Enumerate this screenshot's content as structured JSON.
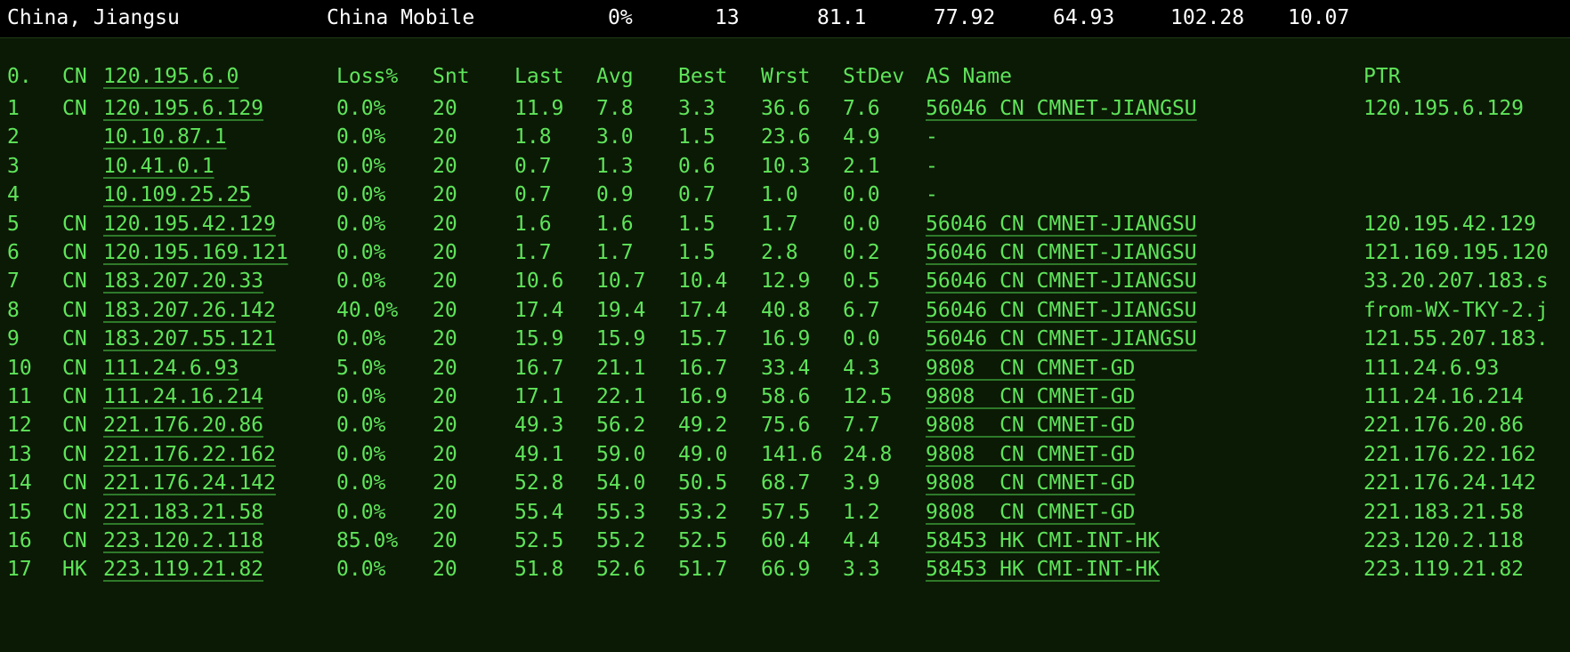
{
  "summary": {
    "location": "China, Jiangsu",
    "isp": "China Mobile",
    "loss": "0%",
    "count": "13",
    "v1": "81.1",
    "v2": "77.92",
    "v3": "64.93",
    "v4": "102.28",
    "v5": "10.07"
  },
  "header": {
    "hop": "0.",
    "cc": "CN",
    "ip": "120.195.6.0",
    "loss": "Loss%",
    "snt": "Snt",
    "last": "Last",
    "avg": "Avg",
    "best": "Best",
    "wrst": "Wrst",
    "stdev": "StDev",
    "as": "AS Name",
    "ptr": "PTR"
  },
  "rows": [
    {
      "hop": "1",
      "cc": "CN",
      "ip": "120.195.6.129",
      "loss": "0.0%",
      "snt": "20",
      "last": "11.9",
      "avg": "7.8",
      "best": "3.3",
      "wrst": "36.6",
      "stdev": "7.6",
      "as": "56046 CN CMNET-JIANGSU",
      "ptr": "120.195.6.129"
    },
    {
      "hop": "2",
      "cc": "",
      "ip": "10.10.87.1",
      "loss": "0.0%",
      "snt": "20",
      "last": "1.8",
      "avg": "3.0",
      "best": "1.5",
      "wrst": "23.6",
      "stdev": "4.9",
      "as": "-",
      "ptr": ""
    },
    {
      "hop": "3",
      "cc": "",
      "ip": "10.41.0.1",
      "loss": "0.0%",
      "snt": "20",
      "last": "0.7",
      "avg": "1.3",
      "best": "0.6",
      "wrst": "10.3",
      "stdev": "2.1",
      "as": "-",
      "ptr": ""
    },
    {
      "hop": "4",
      "cc": "",
      "ip": "10.109.25.25",
      "loss": "0.0%",
      "snt": "20",
      "last": "0.7",
      "avg": "0.9",
      "best": "0.7",
      "wrst": "1.0",
      "stdev": "0.0",
      "as": "-",
      "ptr": ""
    },
    {
      "hop": "5",
      "cc": "CN",
      "ip": "120.195.42.129",
      "loss": "0.0%",
      "snt": "20",
      "last": "1.6",
      "avg": "1.6",
      "best": "1.5",
      "wrst": "1.7",
      "stdev": "0.0",
      "as": "56046 CN CMNET-JIANGSU",
      "ptr": "120.195.42.129"
    },
    {
      "hop": "6",
      "cc": "CN",
      "ip": "120.195.169.121",
      "loss": "0.0%",
      "snt": "20",
      "last": "1.7",
      "avg": "1.7",
      "best": "1.5",
      "wrst": "2.8",
      "stdev": "0.2",
      "as": "56046 CN CMNET-JIANGSU",
      "ptr": "121.169.195.120"
    },
    {
      "hop": "7",
      "cc": "CN",
      "ip": "183.207.20.33",
      "loss": "0.0%",
      "snt": "20",
      "last": "10.6",
      "avg": "10.7",
      "best": "10.4",
      "wrst": "12.9",
      "stdev": "0.5",
      "as": "56046 CN CMNET-JIANGSU",
      "ptr": "33.20.207.183.s"
    },
    {
      "hop": "8",
      "cc": "CN",
      "ip": "183.207.26.142",
      "loss": "40.0%",
      "snt": "20",
      "last": "17.4",
      "avg": "19.4",
      "best": "17.4",
      "wrst": "40.8",
      "stdev": "6.7",
      "as": "56046 CN CMNET-JIANGSU",
      "ptr": "from-WX-TKY-2.j"
    },
    {
      "hop": "9",
      "cc": "CN",
      "ip": "183.207.55.121",
      "loss": "0.0%",
      "snt": "20",
      "last": "15.9",
      "avg": "15.9",
      "best": "15.7",
      "wrst": "16.9",
      "stdev": "0.0",
      "as": "56046 CN CMNET-JIANGSU",
      "ptr": "121.55.207.183."
    },
    {
      "hop": "10",
      "cc": "CN",
      "ip": "111.24.6.93",
      "loss": "5.0%",
      "snt": "20",
      "last": "16.7",
      "avg": "21.1",
      "best": "16.7",
      "wrst": "33.4",
      "stdev": "4.3",
      "as": "9808  CN CMNET-GD",
      "ptr": "111.24.6.93"
    },
    {
      "hop": "11",
      "cc": "CN",
      "ip": "111.24.16.214",
      "loss": "0.0%",
      "snt": "20",
      "last": "17.1",
      "avg": "22.1",
      "best": "16.9",
      "wrst": "58.6",
      "stdev": "12.5",
      "as": "9808  CN CMNET-GD",
      "ptr": "111.24.16.214"
    },
    {
      "hop": "12",
      "cc": "CN",
      "ip": "221.176.20.86",
      "loss": "0.0%",
      "snt": "20",
      "last": "49.3",
      "avg": "56.2",
      "best": "49.2",
      "wrst": "75.6",
      "stdev": "7.7",
      "as": "9808  CN CMNET-GD",
      "ptr": "221.176.20.86"
    },
    {
      "hop": "13",
      "cc": "CN",
      "ip": "221.176.22.162",
      "loss": "0.0%",
      "snt": "20",
      "last": "49.1",
      "avg": "59.0",
      "best": "49.0",
      "wrst": "141.6",
      "stdev": "24.8",
      "as": "9808  CN CMNET-GD",
      "ptr": "221.176.22.162"
    },
    {
      "hop": "14",
      "cc": "CN",
      "ip": "221.176.24.142",
      "loss": "0.0%",
      "snt": "20",
      "last": "52.8",
      "avg": "54.0",
      "best": "50.5",
      "wrst": "68.7",
      "stdev": "3.9",
      "as": "9808  CN CMNET-GD",
      "ptr": "221.176.24.142"
    },
    {
      "hop": "15",
      "cc": "CN",
      "ip": "221.183.21.58",
      "loss": "0.0%",
      "snt": "20",
      "last": "55.4",
      "avg": "55.3",
      "best": "53.2",
      "wrst": "57.5",
      "stdev": "1.2",
      "as": "9808  CN CMNET-GD",
      "ptr": "221.183.21.58"
    },
    {
      "hop": "16",
      "cc": "CN",
      "ip": "223.120.2.118",
      "loss": "85.0%",
      "snt": "20",
      "last": "52.5",
      "avg": "55.2",
      "best": "52.5",
      "wrst": "60.4",
      "stdev": "4.4",
      "as": "58453 HK CMI-INT-HK",
      "ptr": "223.120.2.118"
    },
    {
      "hop": "17",
      "cc": "HK",
      "ip": "223.119.21.82",
      "loss": "0.0%",
      "snt": "20",
      "last": "51.8",
      "avg": "52.6",
      "best": "51.7",
      "wrst": "66.9",
      "stdev": "3.3",
      "as": "58453 HK CMI-INT-HK",
      "ptr": "223.119.21.82"
    }
  ]
}
